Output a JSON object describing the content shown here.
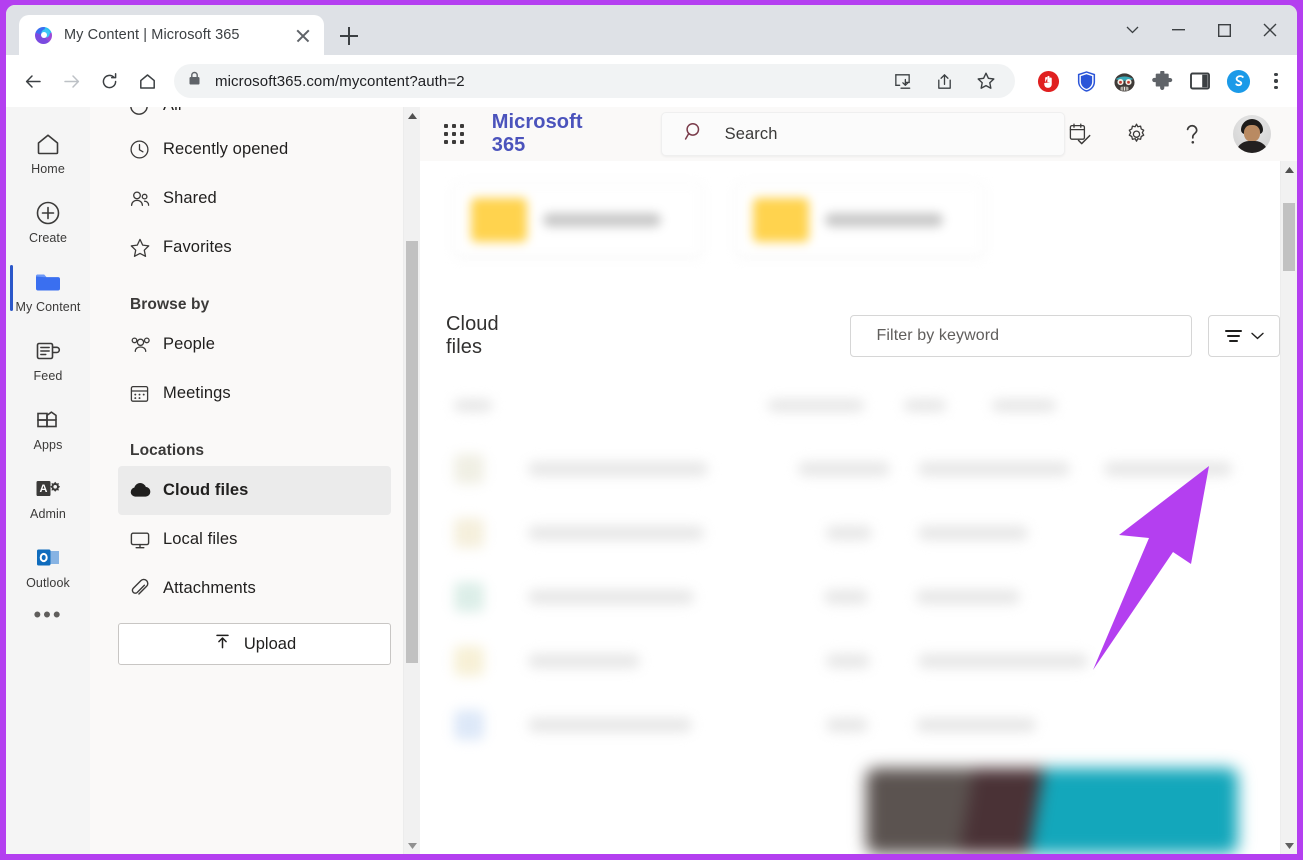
{
  "browser": {
    "tab": {
      "title": "My Content | Microsoft 365",
      "favicon": "microsoft365-copilot-icon",
      "close": "close-tab-icon"
    },
    "new_tab_label": "+",
    "window_controls": [
      "tab-search-chevron",
      "minimize",
      "maximize",
      "close"
    ],
    "nav": {
      "back": "back-arrow-icon",
      "forward": "forward-arrow-icon",
      "reload": "reload-icon",
      "home": "home-icon"
    },
    "address": {
      "lock": "lock-icon",
      "url": "microsoft365.com/mycontent?auth=2"
    },
    "omnibox_actions": [
      "install-app-icon",
      "share-icon",
      "bookmark-star-icon"
    ],
    "extensions": [
      "adblock-icon",
      "shield-icon",
      "privacy-badger-icon",
      "puzzle-extensions-icon",
      "split-screen-icon",
      "sider-hexagon-icon"
    ],
    "menu": "kebab-menu-icon"
  },
  "header": {
    "waffle": "app-launcher-icon",
    "brand": "Microsoft 365",
    "search": {
      "placeholder": "Search",
      "icon": "search-icon"
    },
    "actions": [
      {
        "name": "my-day-icon",
        "label": "My Day"
      },
      {
        "name": "gear-icon",
        "label": "Settings"
      },
      {
        "name": "help-icon",
        "label": "?"
      }
    ],
    "avatar": "user-avatar"
  },
  "rail": {
    "items": [
      {
        "label": "Home",
        "icon": "home-icon",
        "active": false
      },
      {
        "label": "Create",
        "icon": "plus-circle-icon",
        "active": false
      },
      {
        "label": "My Content",
        "icon": "folder-icon",
        "active": true
      },
      {
        "label": "Feed",
        "icon": "feed-icon",
        "active": false
      },
      {
        "label": "Apps",
        "icon": "apps-grid-icon",
        "active": false
      },
      {
        "label": "Admin",
        "icon": "admin-icon",
        "active": false
      },
      {
        "label": "Outlook",
        "icon": "outlook-icon",
        "active": false
      }
    ],
    "more": "•••"
  },
  "sidebar": {
    "cut_off_item": "All",
    "top_items": [
      {
        "label": "Recently opened",
        "icon": "clock-icon"
      },
      {
        "label": "Shared",
        "icon": "people-icon"
      },
      {
        "label": "Favorites",
        "icon": "star-icon"
      }
    ],
    "browse_by_heading": "Browse by",
    "browse_items": [
      {
        "label": "People",
        "icon": "people-group-icon"
      },
      {
        "label": "Meetings",
        "icon": "calendar-icon"
      }
    ],
    "locations_heading": "Locations",
    "location_items": [
      {
        "label": "Cloud files",
        "icon": "cloud-icon",
        "selected": true
      },
      {
        "label": "Local files",
        "icon": "monitor-icon",
        "selected": false
      },
      {
        "label": "Attachments",
        "icon": "paperclip-icon",
        "selected": false
      }
    ],
    "upload": {
      "label": "Upload",
      "icon": "upload-arrow-icon"
    }
  },
  "main": {
    "folders": [
      {
        "name": "",
        "icon": "folder-yellow-icon",
        "blurred": true
      },
      {
        "name": "",
        "icon": "folder-yellow-icon",
        "blurred": true
      }
    ],
    "section_title": "Cloud files",
    "filter_input": {
      "placeholder": "Filter by keyword",
      "value": ""
    },
    "filter_button": {
      "name": "filter-sort-button",
      "icon": "filter-lines-icon",
      "chevron": "chevron-down-icon"
    },
    "file_list_blurred": true
  },
  "annotation": {
    "type": "arrow",
    "color": "#b43ff0",
    "points_to": "filter-sort-button"
  },
  "colors": {
    "frame_purple": "#b43ff0",
    "brand_purple": "#4b53bc",
    "rail_active_indicator": "#2b57c9",
    "folder_yellow": "#ffd34e",
    "page_bg": "#faf9f8"
  }
}
